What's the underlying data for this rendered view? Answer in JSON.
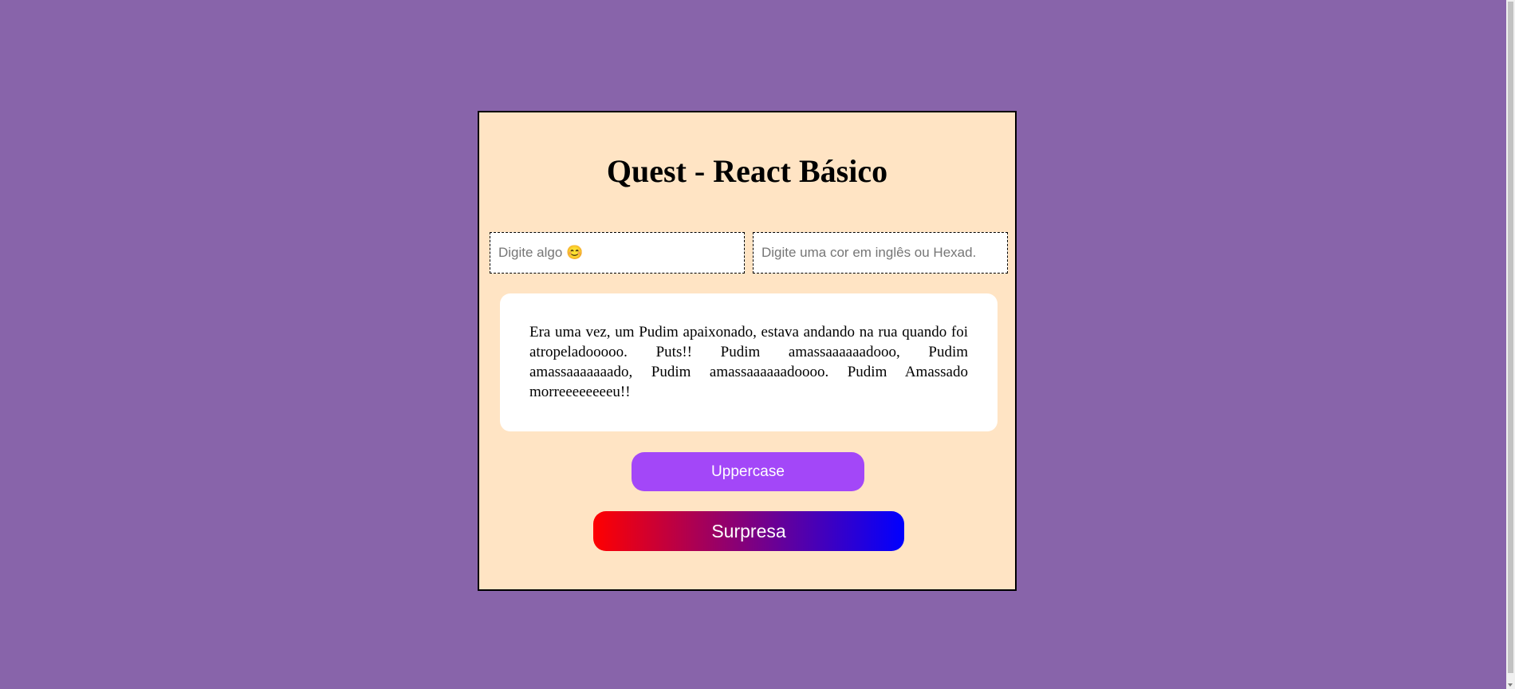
{
  "page": {
    "background_color": "#8864aa",
    "card_background_color": "#ffe4c4"
  },
  "header": {
    "title": "Quest - React Básico"
  },
  "inputs": {
    "text_placeholder": "Digite algo 😊",
    "text_value": "",
    "color_placeholder": "Digite uma cor em inglês ou Hexad.",
    "color_value": ""
  },
  "story": {
    "text": "Era uma vez, um Pudim apaixonado, estava andando na rua quando foi atropeladooooo. Puts!! Pudim amassaaaaaadooo, Pudim amassaaaaaaado, Pudim amassaaaaaadoooo. Pudim Amassado morreeeeeeeeu!!"
  },
  "buttons": {
    "uppercase_label": "Uppercase",
    "uppercase_color": "#a347f8",
    "surprise_label": "Surpresa",
    "surprise_gradient_start": "#ff0000",
    "surprise_gradient_end": "#0000ff"
  }
}
